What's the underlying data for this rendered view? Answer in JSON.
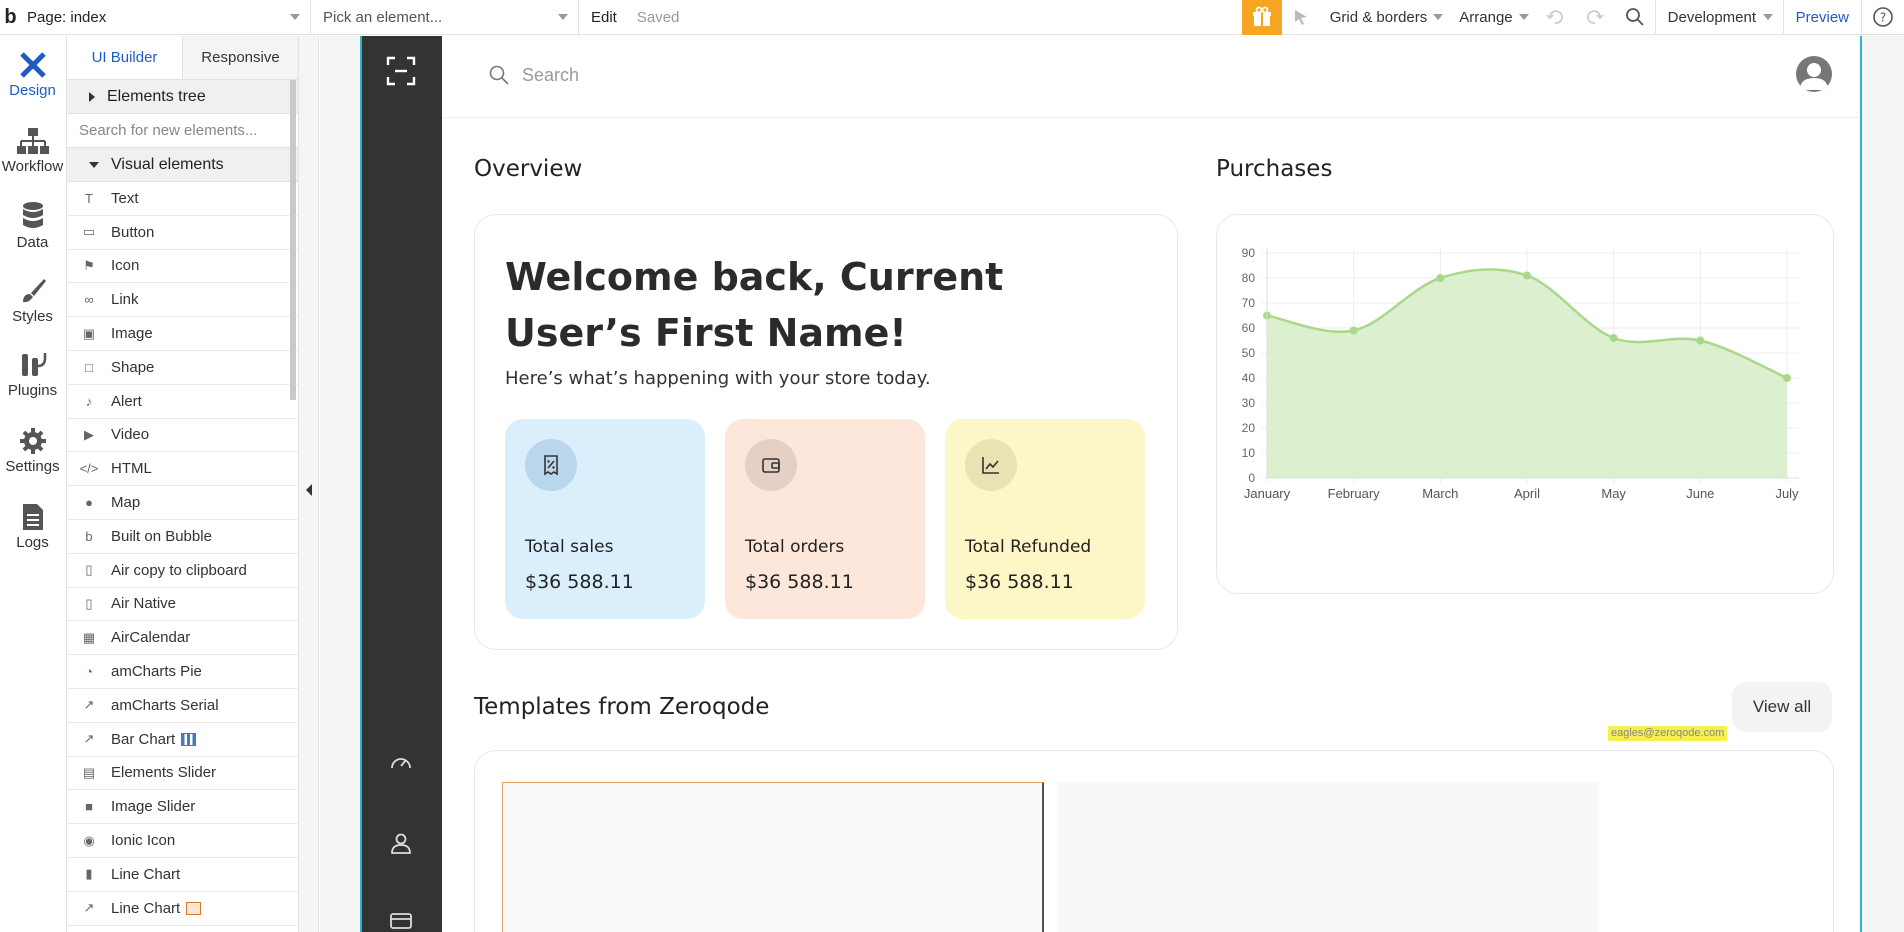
{
  "topbar": {
    "logo": "b",
    "page_selector": "Page: index",
    "element_picker": "Pick an element...",
    "edit": "Edit",
    "saved": "Saved",
    "grid_borders": "Grid & borders",
    "arrange": "Arrange",
    "environment": "Development",
    "preview": "Preview"
  },
  "rail": {
    "items": [
      {
        "label": "Design",
        "icon": "design-icon"
      },
      {
        "label": "Workflow",
        "icon": "workflow-icon"
      },
      {
        "label": "Data",
        "icon": "database-icon"
      },
      {
        "label": "Styles",
        "icon": "brush-icon"
      },
      {
        "label": "Plugins",
        "icon": "plug-icon"
      },
      {
        "label": "Settings",
        "icon": "gear-icon"
      },
      {
        "label": "Logs",
        "icon": "document-icon"
      }
    ]
  },
  "panel": {
    "tabs": [
      "UI Builder",
      "Responsive"
    ],
    "elements_tree": "Elements tree",
    "search_placeholder": "Search for new elements...",
    "visual_elements": "Visual elements",
    "items": [
      {
        "label": "Text",
        "icon": "text-icon"
      },
      {
        "label": "Button",
        "icon": "button-icon"
      },
      {
        "label": "Icon",
        "icon": "flag-icon"
      },
      {
        "label": "Link",
        "icon": "link-icon"
      },
      {
        "label": "Image",
        "icon": "image-icon"
      },
      {
        "label": "Shape",
        "icon": "shape-icon"
      },
      {
        "label": "Alert",
        "icon": "bell-icon"
      },
      {
        "label": "Video",
        "icon": "video-icon"
      },
      {
        "label": "HTML",
        "icon": "code-icon"
      },
      {
        "label": "Map",
        "icon": "pin-icon"
      },
      {
        "label": "Built on Bubble",
        "icon": "bubble-icon"
      },
      {
        "label": "Air copy to clipboard",
        "icon": "clipboard-icon"
      },
      {
        "label": "Air Native",
        "icon": "phone-icon"
      },
      {
        "label": "AirCalendar",
        "icon": "calendar-icon"
      },
      {
        "label": "amCharts Pie",
        "icon": "pie-icon"
      },
      {
        "label": "amCharts Serial",
        "icon": "trend-icon"
      },
      {
        "label": "Bar Chart",
        "icon": "trend-icon"
      },
      {
        "label": "Elements Slider",
        "icon": "slider-icon"
      },
      {
        "label": "Image Slider",
        "icon": "square-icon"
      },
      {
        "label": "Ionic Icon",
        "icon": "radio-icon"
      },
      {
        "label": "Line Chart",
        "icon": "bars-icon"
      },
      {
        "label": "Line Chart",
        "icon": "trend-icon"
      }
    ]
  },
  "app": {
    "search_placeholder": "Search",
    "overview_title": "Overview",
    "purchases_title": "Purchases",
    "welcome_title": "Welcome back, Current User’s First Name!",
    "welcome_sub": "Here’s what’s happening with your store today.",
    "stats": [
      {
        "label": "Total sales",
        "value": "$36 588.11",
        "color": "#dbeefc",
        "icon": "receipt-percent-icon"
      },
      {
        "label": "Total orders",
        "value": "$36 588.11",
        "color": "#fde6da",
        "icon": "wallet-icon"
      },
      {
        "label": "Total Refunded",
        "value": "$36 588.11",
        "color": "#fdf6c6",
        "icon": "chart-line-icon"
      }
    ],
    "templates_title": "Templates from Zeroqode",
    "view_all": "View all",
    "tooltip": "eagles@zeroqode.com"
  },
  "chart_data": {
    "type": "area",
    "categories": [
      "January",
      "February",
      "March",
      "April",
      "May",
      "June",
      "July"
    ],
    "values": [
      65,
      59,
      80,
      81,
      56,
      55,
      40
    ],
    "ylim": [
      0,
      90
    ],
    "yticks": [
      0,
      10,
      20,
      30,
      40,
      50,
      60,
      70,
      80,
      90
    ],
    "grid": true,
    "fill_color": "#dcefcf",
    "line_color": "#a9d88a"
  }
}
